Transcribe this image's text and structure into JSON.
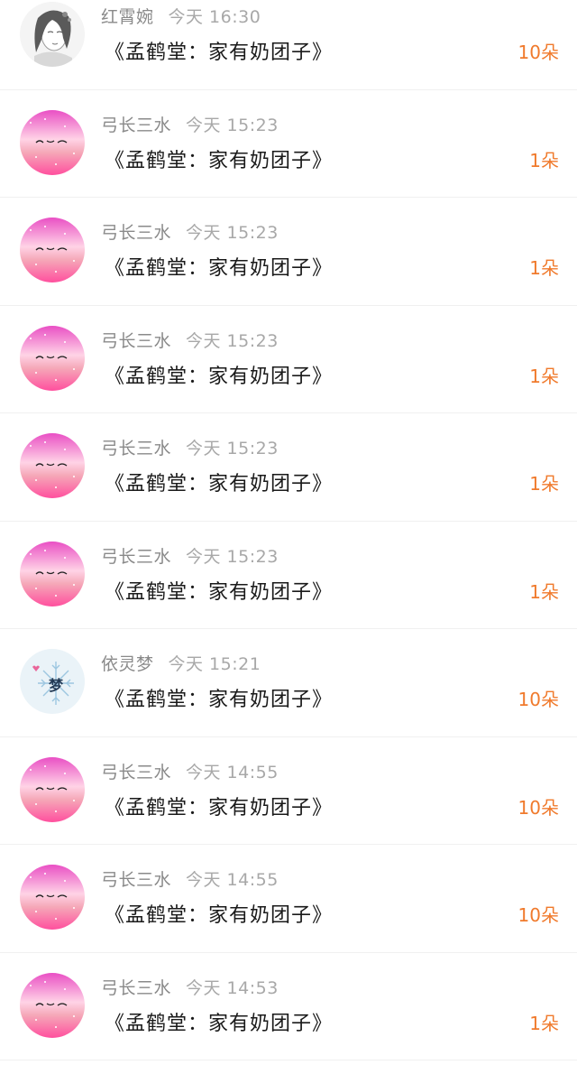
{
  "colors": {
    "accent": "#f07a2c",
    "name_gray": "#8a8a8a",
    "title_text": "#1a1a1a"
  },
  "gifts": [
    {
      "user": "红霄婉",
      "time": "今天 16:30",
      "book": "《孟鹤堂：家有奶团子》",
      "amount": "10朵",
      "avatar": "portrait-sketch"
    },
    {
      "user": "弓长三水",
      "time": "今天 15:23",
      "book": "《孟鹤堂：家有奶团子》",
      "amount": "1朵",
      "avatar": "pink-glitter"
    },
    {
      "user": "弓长三水",
      "time": "今天 15:23",
      "book": "《孟鹤堂：家有奶团子》",
      "amount": "1朵",
      "avatar": "pink-glitter"
    },
    {
      "user": "弓长三水",
      "time": "今天 15:23",
      "book": "《孟鹤堂：家有奶团子》",
      "amount": "1朵",
      "avatar": "pink-glitter"
    },
    {
      "user": "弓长三水",
      "time": "今天 15:23",
      "book": "《孟鹤堂：家有奶团子》",
      "amount": "1朵",
      "avatar": "pink-glitter"
    },
    {
      "user": "弓长三水",
      "time": "今天 15:23",
      "book": "《孟鹤堂：家有奶团子》",
      "amount": "1朵",
      "avatar": "pink-glitter"
    },
    {
      "user": "依灵梦",
      "time": "今天 15:21",
      "book": "《孟鹤堂：家有奶团子》",
      "amount": "10朵",
      "avatar": "snowflake-dream"
    },
    {
      "user": "弓长三水",
      "time": "今天 14:55",
      "book": "《孟鹤堂：家有奶团子》",
      "amount": "10朵",
      "avatar": "pink-glitter"
    },
    {
      "user": "弓长三水",
      "time": "今天 14:55",
      "book": "《孟鹤堂：家有奶团子》",
      "amount": "10朵",
      "avatar": "pink-glitter"
    },
    {
      "user": "弓长三水",
      "time": "今天 14:53",
      "book": "《孟鹤堂：家有奶团子》",
      "amount": "1朵",
      "avatar": "pink-glitter"
    }
  ]
}
